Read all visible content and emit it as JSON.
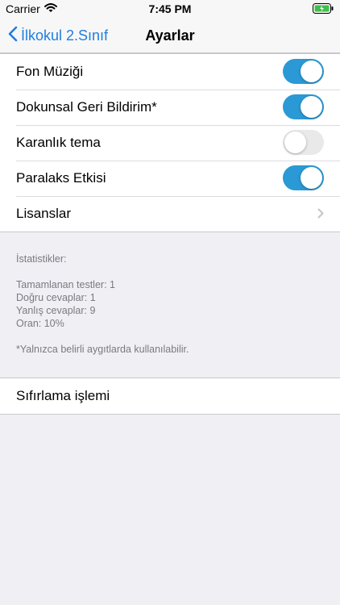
{
  "status_bar": {
    "carrier": "Carrier",
    "time": "7:45 PM"
  },
  "nav": {
    "back_label": "İlkokul 2.Sınıf",
    "title": "Ayarlar"
  },
  "settings": {
    "rows": [
      {
        "label": "Fon Müziği",
        "on": true
      },
      {
        "label": "Dokunsal Geri Bildirim*",
        "on": true
      },
      {
        "label": "Karanlık tema",
        "on": false
      },
      {
        "label": "Paralaks Etkisi",
        "on": true
      },
      {
        "label": "Lisanslar"
      }
    ]
  },
  "stats": {
    "header": "İstatistikler:",
    "completed_tests": "Tamamlanan testler: 1",
    "correct_answers": "Doğru cevaplar: 1",
    "wrong_answers": "Yanlış cevaplar: 9",
    "rate": "Oran: 10%",
    "footnote": "*Yalnızca belirli aygıtlarda kullanılabilir."
  },
  "reset": {
    "label": "Sıfırlama işlemi"
  },
  "colors": {
    "accent": "#1f7ee0",
    "toggle_on": "#2a99d5",
    "background": "#efeff4"
  },
  "icons": [
    "wifi-icon",
    "battery-icon",
    "chevron-left-icon",
    "chevron-right-icon"
  ]
}
